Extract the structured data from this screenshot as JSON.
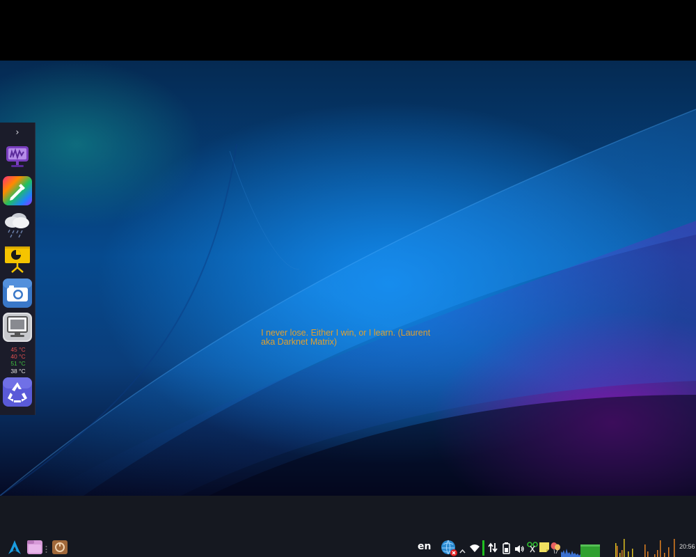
{
  "desktop": {
    "quote_text": "I never lose. Either I win, or I learn. (Laurent aka Darknet Matrix)",
    "quote_color": "#e0a030"
  },
  "dock": {
    "expander_glyph": "›",
    "items": [
      {
        "name": "system-monitor",
        "icon": "monitor-gauge-icon"
      },
      {
        "name": "color-picker",
        "icon": "eyedropper-icon"
      },
      {
        "name": "weather",
        "icon": "weather-rain-cloud-icon"
      },
      {
        "name": "presentation",
        "icon": "presentation-board-icon"
      },
      {
        "name": "screenshot",
        "icon": "camera-icon"
      },
      {
        "name": "computer",
        "icon": "computer-icon"
      },
      {
        "name": "trash",
        "icon": "recycle-icon"
      }
    ],
    "temperatures": [
      {
        "label": "45 °C",
        "color": "#e05050"
      },
      {
        "label": "40 °C",
        "color": "#e05050"
      },
      {
        "label": "51 °C",
        "color": "#40c040"
      },
      {
        "label": "38 °C",
        "color": "#e0e0e0"
      }
    ]
  },
  "taskbar": {
    "launcher_icon": "arch-logo-icon",
    "pinned": [
      {
        "name": "file-manager",
        "icon": "folder-icon"
      },
      {
        "name": "app",
        "icon": "app-icon"
      }
    ],
    "language": "en",
    "tray_icons": [
      "network-globe-icon",
      "chevron-up-icon",
      "wifi-icon",
      "transfer-icon",
      "battery-icon",
      "volume-icon",
      "clipboard-icon",
      "notes-icon",
      "balloons-icon"
    ],
    "clock": "20:56",
    "accent_green": "#20c020",
    "accent_orange": "#e08020",
    "accent_yellow": "#e0c020"
  }
}
